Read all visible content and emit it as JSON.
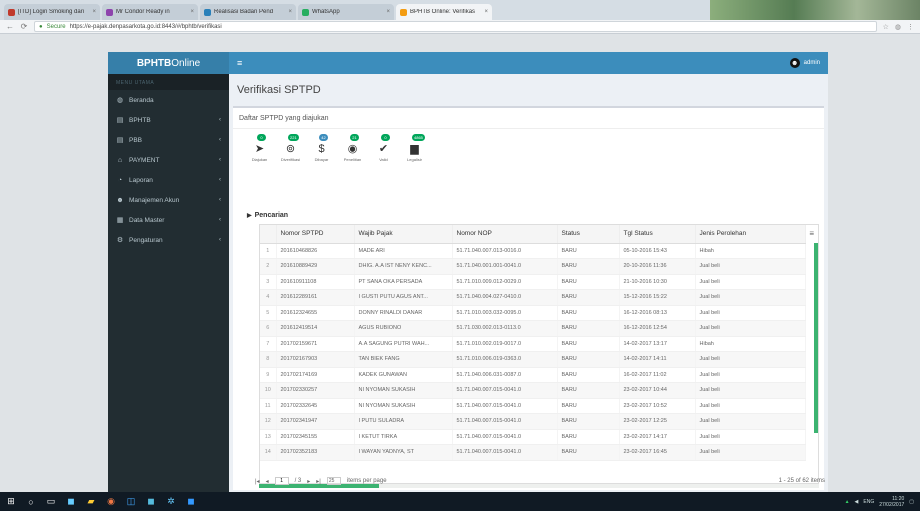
{
  "browser": {
    "tabs": [
      {
        "title": "[ITD] Login Smoking dari",
        "active": false,
        "color": "#c0392b"
      },
      {
        "title": "Mr Condor Ready in",
        "active": false,
        "color": "#8e44ad"
      },
      {
        "title": "Realisasi Badan Pend",
        "active": false,
        "color": "#2980b9"
      },
      {
        "title": "WhatsApp",
        "active": false,
        "color": "#27ae60"
      },
      {
        "title": "BPHTB Online: Verifikas",
        "active": true,
        "color": "#f39c12"
      }
    ],
    "secure_label": "Secure",
    "url": "https://e-pajak.denpasarkota.go.id:8443/#/bphtb/verifikasi"
  },
  "brand": {
    "bold": "BPHTB",
    "light": "Online"
  },
  "sidebar": {
    "header": "MENU UTAMA",
    "items": [
      {
        "label": "Beranda",
        "icon": "dashboard-icon",
        "glyph": "◍",
        "arrow": ""
      },
      {
        "label": "BPHTB",
        "icon": "file-icon",
        "glyph": "▤",
        "arrow": "‹"
      },
      {
        "label": "PBB",
        "icon": "file-icon",
        "glyph": "▤",
        "arrow": "‹"
      },
      {
        "label": "PAYMENT",
        "icon": "bank-icon",
        "glyph": "⌂",
        "arrow": "‹"
      },
      {
        "label": "Laporan",
        "icon": "chart-icon",
        "glyph": "◔",
        "arrow": "‹"
      },
      {
        "label": "Manajemen Akun",
        "icon": "users-icon",
        "glyph": "☻",
        "arrow": "‹"
      },
      {
        "label": "Data Master",
        "icon": "book-icon",
        "glyph": "▦",
        "arrow": "‹"
      },
      {
        "label": "Pengaturan",
        "icon": "settings-icon",
        "glyph": "⚙",
        "arrow": "‹"
      }
    ]
  },
  "topbar": {
    "menu_glyph": "≡",
    "user": "admin"
  },
  "page": {
    "title": "Verifikasi SPTPD",
    "box_title": "Daftar SPTPD yang diajukan",
    "search_label": "Pencarian"
  },
  "toolbar": [
    {
      "label": "Diajukan",
      "glyph": "➤",
      "badge": "0",
      "badge_color": "green",
      "icon": "send-icon"
    },
    {
      "label": "Diverifikasi",
      "glyph": "⊚",
      "badge": "221",
      "badge_color": "green",
      "icon": "verified-icon"
    },
    {
      "label": "Dibayar",
      "glyph": "$",
      "badge": "42",
      "badge_color": "blue",
      "icon": "dollar-icon"
    },
    {
      "label": "Penelitian",
      "glyph": "◉",
      "badge": "21",
      "badge_color": "green",
      "icon": "eye-icon"
    },
    {
      "label": "Valid",
      "glyph": "✔",
      "badge": "0",
      "badge_color": "green",
      "icon": "check-icon"
    },
    {
      "label": "Legalisir",
      "glyph": "▆",
      "badge": "4865",
      "badge_color": "green",
      "icon": "document-icon"
    }
  ],
  "table": {
    "columns": [
      "",
      "Nomor SPTPD",
      "Wajib Pajak",
      "Nomor NOP",
      "Status",
      "Tgl Status",
      "Jenis Perolehan"
    ],
    "rows": [
      [
        "1",
        "201610468826",
        "MADE ARI",
        "51.71.040.007.013-0016.0",
        "BARU",
        "05-10-2016 15:43",
        "Hibah"
      ],
      [
        "2",
        "201610889429",
        "DHIG. A.A IST NENY KENC...",
        "51.71.040.001.001-0041.0",
        "BARU",
        "20-10-2016 11:36",
        "Jual beli"
      ],
      [
        "3",
        "201610911108",
        "PT SANA OKA PERSADA",
        "51.71.010.009.012-0029.0",
        "BARU",
        "21-10-2016 10:30",
        "Jual beli"
      ],
      [
        "4",
        "201612289161",
        "I GUSTI PUTU AGUS ANT...",
        "51.71.040.004.027-0410.0",
        "BARU",
        "15-12-2016 15:22",
        "Jual beli"
      ],
      [
        "5",
        "201612324655",
        "DONNY RINALDI DANAR",
        "51.71.010.003.032-0095.0",
        "BARU",
        "16-12-2016 08:13",
        "Jual beli"
      ],
      [
        "6",
        "201612419514",
        "AGUS RUBIONO",
        "51.71.030.002.013-0113.0",
        "BARU",
        "16-12-2016 12:54",
        "Jual beli"
      ],
      [
        "7",
        "201702159671",
        "A.A SAGUNG PUTRI WAH...",
        "51.71.010.002.019-0017.0",
        "BARU",
        "14-02-2017 13:17",
        "Hibah"
      ],
      [
        "8",
        "201702167903",
        "TAN BIEK FANG",
        "51.71.010.006.019-0363.0",
        "BARU",
        "14-02-2017 14:11",
        "Jual beli"
      ],
      [
        "9",
        "201702174169",
        "KADEK GUNAWAN",
        "51.71.040.006.031-0087.0",
        "BARU",
        "16-02-2017 11:02",
        "Jual beli"
      ],
      [
        "10",
        "201702330257",
        "NI NYOMAN SUKASIH",
        "51.71.040.007.015-0041.0",
        "BARU",
        "23-02-2017 10:44",
        "Jual beli"
      ],
      [
        "11",
        "201702332645",
        "NI NYOMAN SUKASIH",
        "51.71.040.007.015-0041.0",
        "BARU",
        "23-02-2017 10:52",
        "Jual beli"
      ],
      [
        "12",
        "201702341947",
        "I PUTU SULADRA",
        "51.71.040.007.015-0041.0",
        "BARU",
        "23-02-2017 12:25",
        "Jual beli"
      ],
      [
        "13",
        "201702345155",
        "I KETUT TIRKA",
        "51.71.040.007.015-0041.0",
        "BARU",
        "23-02-2017 14:17",
        "Jual beli"
      ],
      [
        "14",
        "201702352183",
        "I WAYAN YADNYA, ST",
        "51.71.040.007.015-0041.0",
        "BARU",
        "23-02-2017 16:45",
        "Jual beli"
      ]
    ]
  },
  "pager": {
    "first": "|◂",
    "prev": "◂",
    "page": "1",
    "of": "/ 3",
    "next": "▸",
    "last": "▸|",
    "size": "25",
    "per_page": "items per page",
    "info": "1 - 25 of 62 items"
  },
  "taskbar": {
    "time": "11:20",
    "date": "27/02/2017",
    "lang": "ENG"
  }
}
